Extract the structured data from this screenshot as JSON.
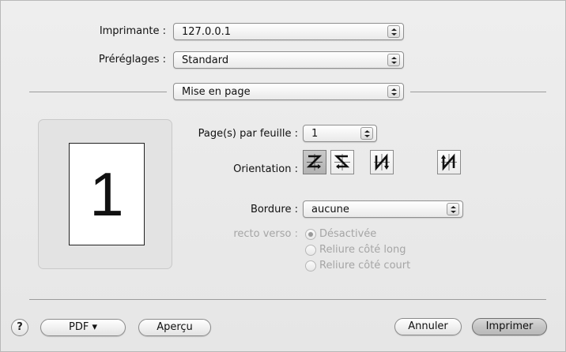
{
  "printer": {
    "label": "Imprimante :",
    "value": "127.0.0.1"
  },
  "presets": {
    "label": "Préréglages :",
    "value": "Standard"
  },
  "panel_menu": {
    "value": "Mise en page"
  },
  "layout": {
    "pages_per_sheet": {
      "label": "Page(s) par feuille :",
      "value": "1"
    },
    "orientation": {
      "label": "Orientation :",
      "options": [
        {
          "icon": "orientation-z-left-right-icon",
          "selected": true
        },
        {
          "icon": "orientation-s-right-left-icon",
          "selected": false
        },
        {
          "icon": "orientation-n-top-bottom-icon",
          "selected": false
        },
        {
          "icon": "orientation-n-bottom-top-icon",
          "selected": false
        }
      ]
    },
    "border": {
      "label": "Bordure :",
      "value": "aucune"
    },
    "duplex": {
      "label": "recto verso :",
      "options": [
        {
          "label": "Désactivée",
          "selected": true
        },
        {
          "label": "Reliure côté long",
          "selected": false
        },
        {
          "label": "Reliure côté court",
          "selected": false
        }
      ],
      "enabled": false
    }
  },
  "preview": {
    "page_number": "1"
  },
  "footer": {
    "help_label": "?",
    "pdf_label": "PDF ▾",
    "preview_label": "Aperçu",
    "cancel_label": "Annuler",
    "print_label": "Imprimer"
  },
  "colors": {
    "window_bg": "#ececec",
    "disabled_text": "#a5a5a5",
    "selected_orientation_bg": "#b9b9b9"
  }
}
